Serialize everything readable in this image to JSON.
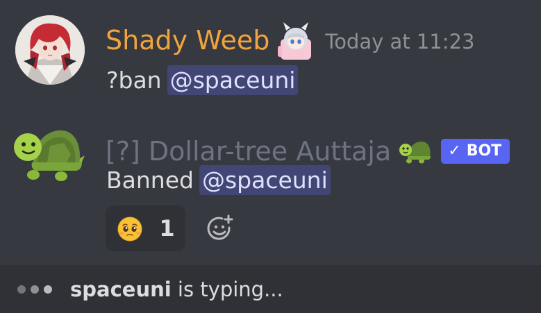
{
  "messages": [
    {
      "username": "Shady Weeb",
      "timestamp": "Today at 11:23",
      "command": "?ban",
      "mention": "@spaceuni",
      "avatar": "anime-girl-avatar",
      "role_icon": "anime-girl-icon"
    },
    {
      "username": "[?] Dollar-tree Auttaja",
      "role_icon": "turtle-icon",
      "bot_tag": "BOT",
      "bot_tag_check": "✓",
      "text": "Banned",
      "mention": "@spaceuni",
      "avatar": "turtle-avatar",
      "reaction": {
        "emoji": "pleading-face-icon",
        "count": "1"
      },
      "add_reaction_icon": "add-reaction-icon"
    }
  ],
  "typing": {
    "user": "spaceuni",
    "suffix": " is typing..."
  },
  "colors": {
    "background": "#36393f",
    "username_human": "#f1a340",
    "username_bot": "#6d7381",
    "mention_bg": "#414675",
    "bot_tag": "#5865f2",
    "typing_bg": "#2f3136"
  }
}
